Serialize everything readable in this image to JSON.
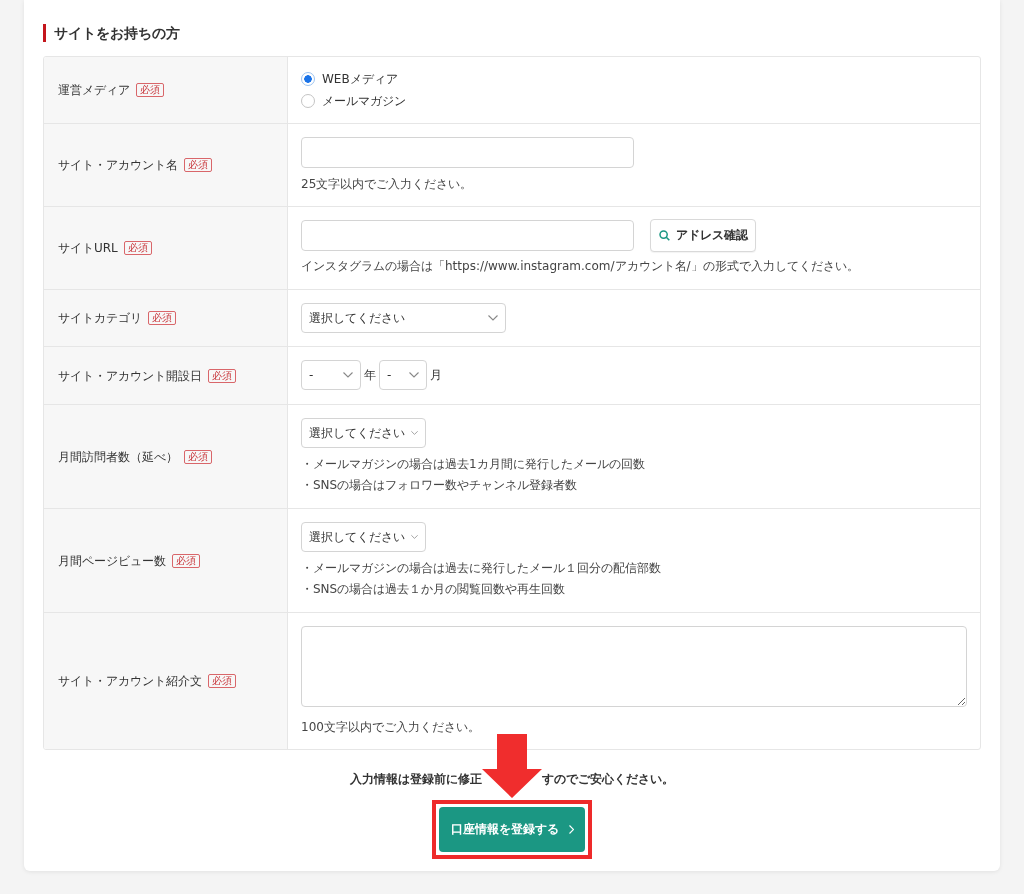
{
  "section": {
    "title": "サイトをお持ちの方"
  },
  "form": {
    "rows": [
      {
        "kind": "radio",
        "label": "運営メディア",
        "badge": "必須",
        "options": [
          {
            "label": "WEBメディア",
            "selected": true
          },
          {
            "label": "メールマガジン",
            "selected": false
          }
        ]
      },
      {
        "kind": "text",
        "label": "サイト・アカウント名",
        "badge": "必須",
        "notes": [
          "25文字以内でご入力ください。"
        ]
      },
      {
        "kind": "text_with_button",
        "label": "サイトURL",
        "badge": "必須",
        "button": "アドレス確認",
        "notes": [
          "インスタグラムの場合は「https://www.instagram.com/アカウント名/」の形式で入力してください。"
        ]
      },
      {
        "kind": "wide_select",
        "label": "サイトカテゴリ",
        "badge": "必須",
        "value": "選択してください"
      },
      {
        "kind": "date",
        "label": "サイト・アカウント開設日",
        "badge": "必須",
        "parts": [
          {
            "value": "-",
            "unit": "年"
          },
          {
            "value": "-",
            "unit": "月"
          }
        ]
      },
      {
        "kind": "select",
        "label": "月間訪問者数（延べ）",
        "badge": "必須",
        "value": "選択してください",
        "notes": [
          "・メールマガジンの場合は過去1カ月間に発行したメールの回数",
          "・SNSの場合はフォロワー数やチャンネル登録者数"
        ]
      },
      {
        "kind": "select",
        "label": "月間ページビュー数",
        "badge": "必須",
        "value": "選択してください",
        "notes": [
          "・メールマガジンの場合は過去に発行したメール１回分の配信部数",
          "・SNSの場合は過去１か月の閲覧回数や再生回数"
        ]
      },
      {
        "kind": "textarea",
        "label": "サイト・アカウント紹介文",
        "badge": "必須",
        "notes": [
          "100文字以内でご入力ください。"
        ]
      }
    ]
  },
  "footer": {
    "note_parts": [
      "入力情報は登録前に修正",
      "すのでご安心ください。"
    ],
    "submit": "口座情報を登録する"
  }
}
